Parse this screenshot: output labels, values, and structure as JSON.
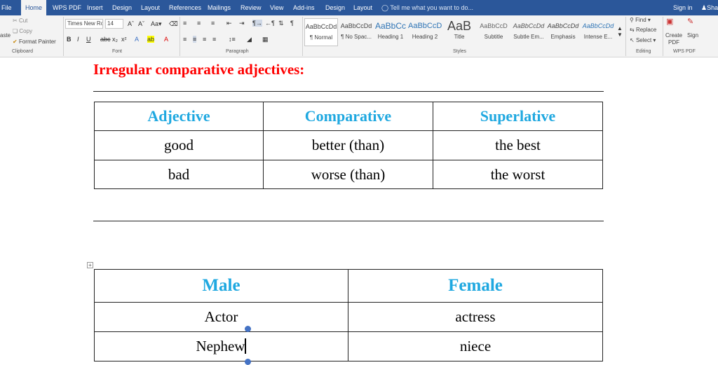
{
  "tabs": [
    "File",
    "Home",
    "WPS PDF",
    "Insert",
    "Design",
    "Layout",
    "References",
    "Mailings",
    "Review",
    "View",
    "Add-ins",
    "Design",
    "Layout"
  ],
  "tell_me": "Tell me what you want to do...",
  "sign_in": "Sign in",
  "share": "Shar",
  "clipboard": {
    "paste": "aste",
    "cut": "Cut",
    "copy": "Copy",
    "format_painter": "Format Painter",
    "label": "Clipboard"
  },
  "font": {
    "name": "Times New Ro",
    "size": "14",
    "label": "Font"
  },
  "paragraph": {
    "label": "Paragraph"
  },
  "styles": {
    "items": [
      {
        "sample": "AaBbCcDd",
        "name": "¶ Normal"
      },
      {
        "sample": "AaBbCcDd",
        "name": "¶ No Spac..."
      },
      {
        "sample": "AaBbCc",
        "name": "Heading 1"
      },
      {
        "sample": "AaBbCcD",
        "name": "Heading 2"
      },
      {
        "sample": "AaB",
        "name": "Title"
      },
      {
        "sample": "AaBbCcD",
        "name": "Subtitle"
      },
      {
        "sample": "AaBbCcDd",
        "name": "Subtle Em..."
      },
      {
        "sample": "AaBbCcDd",
        "name": "Emphasis"
      },
      {
        "sample": "AaBbCcDd",
        "name": "Intense E..."
      }
    ],
    "label": "Styles"
  },
  "editing": {
    "find": "Find",
    "replace": "Replace",
    "select": "Select",
    "label": "Editing"
  },
  "wps_pdf": {
    "create": "Create PDF",
    "sign": "Sign",
    "label": "WPS PDF"
  },
  "document": {
    "heading": "Irregular comparative adjectives:",
    "table1": {
      "headers": [
        "Adjective",
        "Comparative",
        "Superlative"
      ],
      "rows": [
        [
          "good",
          "better (than)",
          "the best"
        ],
        [
          "bad",
          "worse (than)",
          "the worst"
        ]
      ]
    },
    "table2": {
      "headers": [
        "Male",
        "Female"
      ],
      "rows": [
        [
          "Actor",
          "actress"
        ],
        [
          "Nephew",
          "niece"
        ]
      ]
    }
  },
  "colors": {
    "ribbon_tab_bar": "#2b579a",
    "heading": "#ff0000",
    "table_header": "#1fa8e0"
  }
}
